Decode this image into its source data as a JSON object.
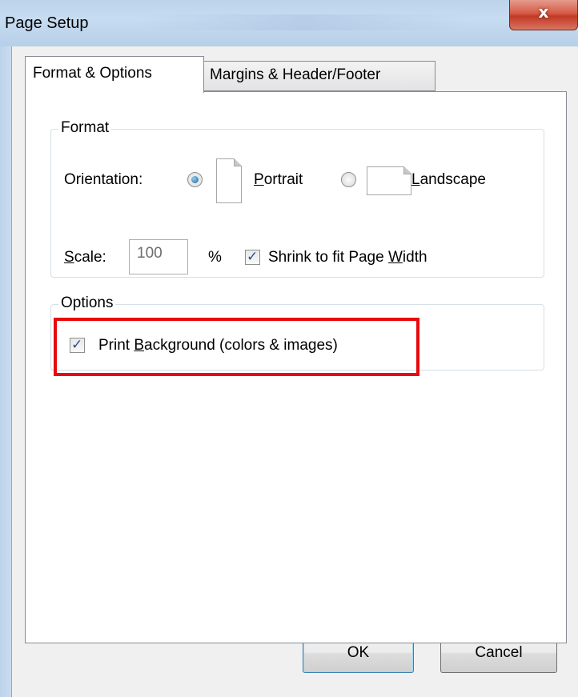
{
  "window": {
    "title": "Page Setup",
    "close_icon": "close-icon",
    "close_glyph": "x",
    "accent_close": "#c13a25"
  },
  "tabs": [
    {
      "label": "Format & Options",
      "active": true
    },
    {
      "label": "Margins & Header/Footer",
      "active": false
    }
  ],
  "format": {
    "legend": "Format",
    "orientation_label": "Orientation:",
    "portrait_label": "Portrait",
    "portrait_selected": true,
    "landscape_label": "Landscape",
    "landscape_selected": false,
    "scale_label": "Scale:",
    "scale_value": "100",
    "percent_label": "%",
    "shrink_label": "Shrink to fit Page Width",
    "shrink_checked": true
  },
  "options": {
    "legend": "Options",
    "print_background_label": "Print Background (colors & images)",
    "print_background_checked": true,
    "highlight_color": "#e8090e"
  },
  "buttons": {
    "ok": "OK",
    "cancel": "Cancel"
  }
}
